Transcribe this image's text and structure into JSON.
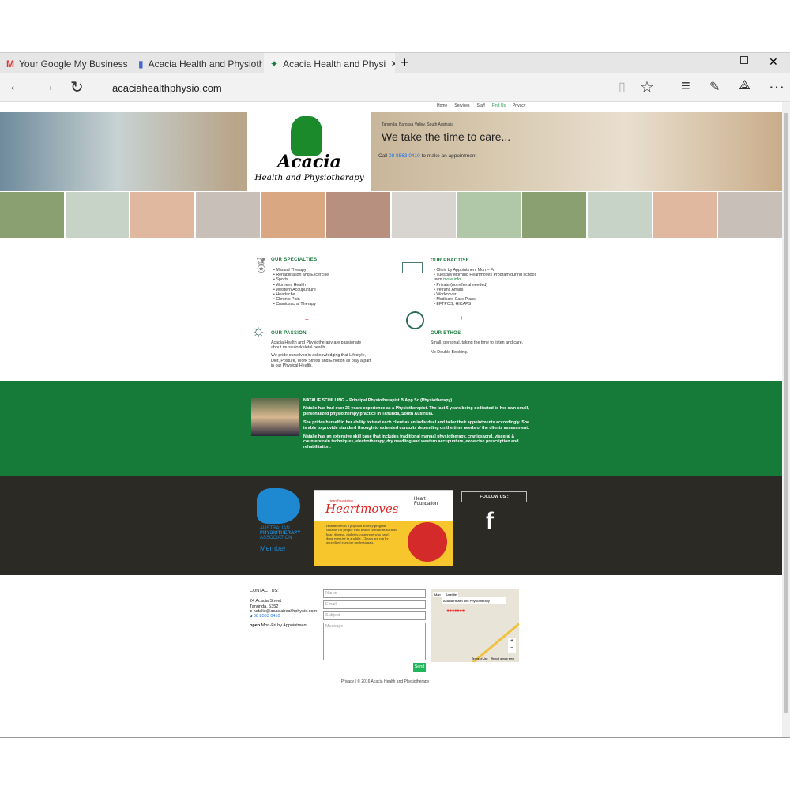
{
  "browser": {
    "tabs": [
      {
        "label": "Your Google My Business Pa",
        "icon": "gmail-icon"
      },
      {
        "label": "Acacia Health and Physiothe",
        "icon": "google-my-business-icon"
      },
      {
        "label": "Acacia Health and Physi",
        "icon": "acacia-favicon"
      }
    ],
    "url": "acaciahealthphysio.com"
  },
  "nav": [
    "Home",
    "Services",
    "Staff",
    "Find Us",
    "Privacy"
  ],
  "hero": {
    "location": "Tanunda, Barossa Valley, South Australia",
    "tagline": "We take the time to care...",
    "call_prefix": "Call ",
    "phone": "08 8563 0410",
    "call_suffix": " to make an appointment",
    "logo_text": "Acacia",
    "logo_sub": "Health and Physiotherapy"
  },
  "specialties": {
    "title": "OUR SPECIALTIES",
    "items": [
      "Manual Therapy",
      "Rehabilitation and Excercise",
      "Sports",
      "Womens Health",
      "Western Accupunture",
      "Headache",
      "Chronic Pain",
      "Craniosacral Therapy"
    ]
  },
  "practise": {
    "title": "OUR PRACTISE",
    "items": [
      "Clinic by Appointment Mon – Fri",
      "Tuesday Morning Heartmoves Program during school term",
      "Private (no referral needed)",
      "Vetrans Affairs",
      "Workcover",
      "Medicare Care Plans",
      "EFTPOS, HICAPS"
    ],
    "more_info": "more info"
  },
  "passion": {
    "title": "OUR PASSION",
    "p1": "Acacia Health and Physiotherapy are passionate about musculoskeletal health.",
    "p2": "We pride ourselves in acknowledging that Lifestyle, Diet, Posture, Work Stress and Emotion all play a part in our Physical Health."
  },
  "ethos": {
    "title": "OUR ETHOS",
    "p1": "Small, personal, taking the time to listen and care.",
    "p2": "No Double Booking."
  },
  "staff": {
    "heading": "NATALIE SCHILLING – Principal Physiotherapist B.App.Sc (Physiotherapy)",
    "p1": "Natalie has had over 25 years experience as a Physiotherapist. The last 6 years being dedicated to her own small, personalized physiotherapy practice in Tanunda, South Australia.",
    "p2": "She prides herself in her ability to treat each client as an individual and tailor their appointments accordingly. She is able to provide standard through to extended consults depending on the time needs of the clients assessment.",
    "p3": "Natalie has an extensive skill base that includes traditional manual physiotherapy, craniosacral, visceral & counterstrain techniques, electrotherapy, dry needling and western accupunture, excercise prescription and rehabilitation."
  },
  "partners": {
    "apa": [
      "AUSTRALIAN",
      "PHYSIOTHERAPY",
      "ASSOCIATION",
      "Member"
    ],
    "heartmoves_small": "Heart Foundation",
    "heartmoves_title": "Heartmoves",
    "heart_foundation": "Heart Foundation",
    "heartmoves_text": "Heartmoves is a physical activity program suitable for people with health conditions such as heart disease, diabetes, or anyone who hasn't done exercise in a while. Classes are run by accredited exercise professionals.",
    "follow": "FOLLOW US :"
  },
  "contact": {
    "title": "CONTACT US:",
    "street": "24 Acacia Street",
    "town": "Tanunda, 5352",
    "email_label": "e",
    "email": "natalie@acaciahealthphysio.com",
    "phone_label": "p",
    "phone": "08 8563 0410",
    "open_label": "open",
    "open": "Mon-Fri by Appointment"
  },
  "form": {
    "name": "Name",
    "email": "Email",
    "subject": "Subject",
    "message": "Message",
    "send": "Send"
  },
  "map": {
    "tab_map": "Map",
    "tab_sat": "Satellite",
    "popup": "Acacia Health and Physiotherapy",
    "terms": "Terms of Use",
    "report": "Report a map error"
  },
  "footer": "Privacy | © 2016 Acacia Health and Physiotherapy",
  "colors": {
    "green": "#167a38",
    "dark": "#2c2a25",
    "link": "#1a73e8"
  }
}
